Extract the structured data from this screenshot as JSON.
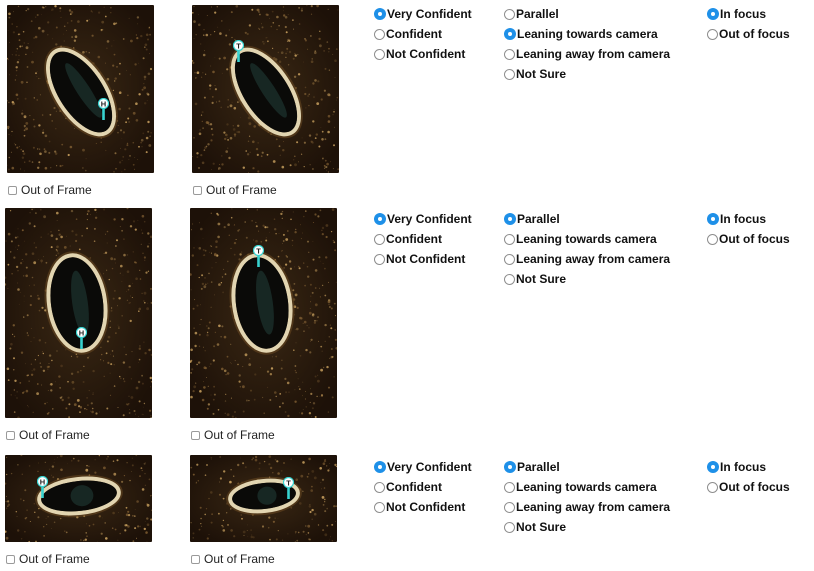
{
  "rows": [
    {
      "checkbox_label": "Out of Frame",
      "head_marker": "H",
      "tail_marker": "T",
      "confidence": {
        "options": [
          "Very Confident",
          "Confident",
          "Not Confident"
        ],
        "selected": "Very Confident"
      },
      "orientation": {
        "options": [
          "Parallel",
          "Leaning towards camera",
          "Leaning away from camera",
          "Not Sure"
        ],
        "selected": "Leaning towards camera"
      },
      "focus": {
        "options": [
          "In focus",
          "Out of focus"
        ],
        "selected": "In focus"
      }
    },
    {
      "checkbox_label": "Out of Frame",
      "head_marker": "H",
      "tail_marker": "T",
      "confidence": {
        "options": [
          "Very Confident",
          "Confident",
          "Not Confident"
        ],
        "selected": "Very Confident"
      },
      "orientation": {
        "options": [
          "Parallel",
          "Leaning towards camera",
          "Leaning away from camera",
          "Not Sure"
        ],
        "selected": "Parallel"
      },
      "focus": {
        "options": [
          "In focus",
          "Out of focus"
        ],
        "selected": "In focus"
      }
    },
    {
      "checkbox_label": "Out of Frame",
      "head_marker": "H",
      "tail_marker": "T",
      "confidence": {
        "options": [
          "Very Confident",
          "Confident",
          "Not Confident"
        ],
        "selected": "Very Confident"
      },
      "orientation": {
        "options": [
          "Parallel",
          "Leaning towards camera",
          "Leaning away from camera",
          "Not Sure"
        ],
        "selected": "Parallel"
      },
      "focus": {
        "options": [
          "In focus",
          "Out of focus"
        ],
        "selected": "In focus"
      }
    }
  ],
  "colors": {
    "radio_selected": "#1e90e8",
    "marker": "#37d3d0",
    "image_bg": "#2a1a0c"
  }
}
